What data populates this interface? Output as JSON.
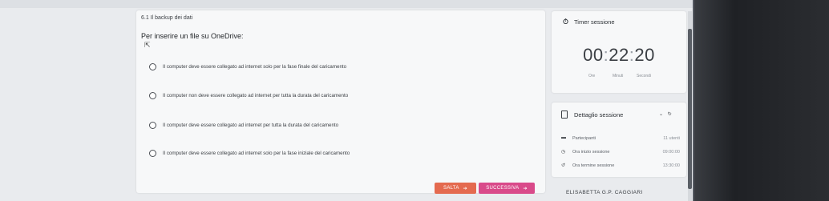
{
  "question": {
    "number": "6.1 Il backup dei dati",
    "prompt": "Per inserire un file su OneDrive:",
    "options": [
      "Il computer deve essere collegato ad internet solo per la fase finale del caricamento",
      "Il computer non deve essere collegato ad internet per tutta la durata del caricamento",
      "Il computer deve essere collegato ad internet per tutta la durata del caricamento",
      "Il computer deve essere collegato ad internet solo per la fase iniziale del caricamento"
    ]
  },
  "buttons": {
    "skip": "SALTA",
    "next": "SUCCESSIVA"
  },
  "timer": {
    "title": "Timer sessione",
    "hours": "00",
    "minutes": "22",
    "seconds": "20",
    "unit_hours": "Ore",
    "unit_minutes": "Minuti",
    "unit_seconds": "Secondi"
  },
  "session": {
    "title": "Dettaglio sessione",
    "participants_label": "Partecipanti",
    "participants_value": "11 utenti",
    "start_label": "Ora inizio sessione",
    "start_value": "09:00:00",
    "end_label": "Ora termine sessione",
    "end_value": "13:30:00"
  },
  "footer": {
    "user_name": "ELISABETTA G.P. CAGGIARI"
  },
  "colors": {
    "skip_button": "#e46a4f",
    "next_button": "#d94a8a"
  }
}
